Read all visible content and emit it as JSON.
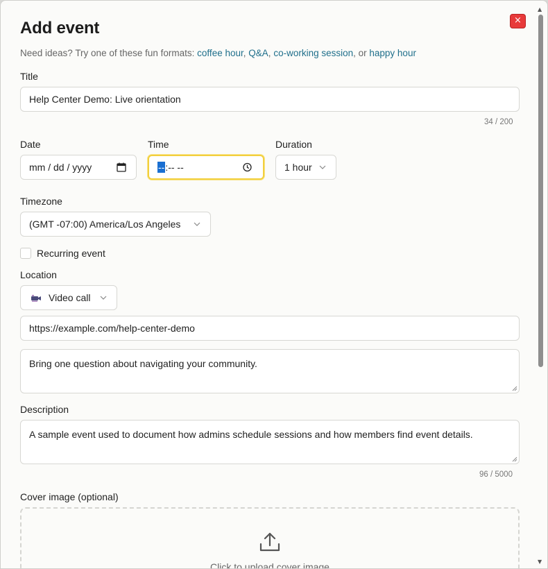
{
  "dialog": {
    "title": "Add event",
    "close_label": "×",
    "ideas": {
      "prefix": "Need ideas? Try one of these fun formats:",
      "links": [
        "coffee hour",
        "Q&A",
        "co-working session",
        "happy hour"
      ],
      "sep1": ",",
      "sep2": ",",
      "sep3": ", or"
    }
  },
  "title_field": {
    "label": "Title",
    "value": "Help Center Demo: Live orientation",
    "counter": "34 / 200"
  },
  "date_field": {
    "label": "Date",
    "placeholder": "mm / dd / yyyy"
  },
  "time_field": {
    "label": "Time",
    "selected_segment": "--",
    "rest": ":-- --"
  },
  "duration_field": {
    "label": "Duration",
    "value": "1 hour"
  },
  "timezone_field": {
    "label": "Timezone",
    "value": "(GMT -07:00) America/Los Angeles"
  },
  "recurring": {
    "label": "Recurring event",
    "checked": false
  },
  "location": {
    "label": "Location",
    "type": "Video call",
    "url": "https://example.com/help-center-demo",
    "notes": "Bring one question about navigating your community."
  },
  "description": {
    "label": "Description",
    "value": "A sample event used to document how admins schedule sessions and how members find event details.",
    "counter": "96 / 5000"
  },
  "cover_image": {
    "label": "Cover image (optional)",
    "upload_text": "Click to upload cover image"
  },
  "colors": {
    "accent_link": "#1f6f8b",
    "close_red": "#e83a3a",
    "focus_yellow": "#f2cf3d"
  }
}
